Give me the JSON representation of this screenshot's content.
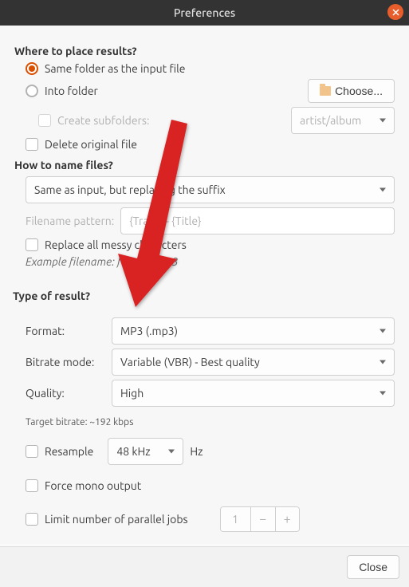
{
  "title": "Preferences",
  "sections": {
    "where": {
      "heading": "Where to place results?",
      "same_folder": "Same folder as the input file",
      "into_folder": "Into folder",
      "choose_btn": "Choose...",
      "create_subfolders": "Create subfolders:",
      "subfolder_pattern": "artist/album",
      "delete_original": "Delete original file"
    },
    "naming": {
      "heading": "How to name files?",
      "mode": "Same as input, but replacing the suffix",
      "pattern_label": "Filename pattern:",
      "pattern_value": "{Track} - {Title}",
      "replace_messy": "Replace all messy characters",
      "example_label": "Example filename:",
      "example_value": "foo/bar.mp3"
    },
    "result": {
      "heading": "Type of result?",
      "format_label": "Format:",
      "format_value": "MP3 (.mp3)",
      "bitrate_label": "Bitrate mode:",
      "bitrate_value": "Variable (VBR) - Best quality",
      "quality_label": "Quality:",
      "quality_value": "High",
      "target_bitrate": "Target bitrate: ~192 kbps",
      "resample_label": "Resample",
      "resample_value": "48 kHz",
      "resample_unit": "Hz",
      "force_mono": "Force mono output",
      "limit_jobs": "Limit number of parallel jobs",
      "jobs_value": "1"
    }
  },
  "footer": {
    "close": "Close"
  }
}
